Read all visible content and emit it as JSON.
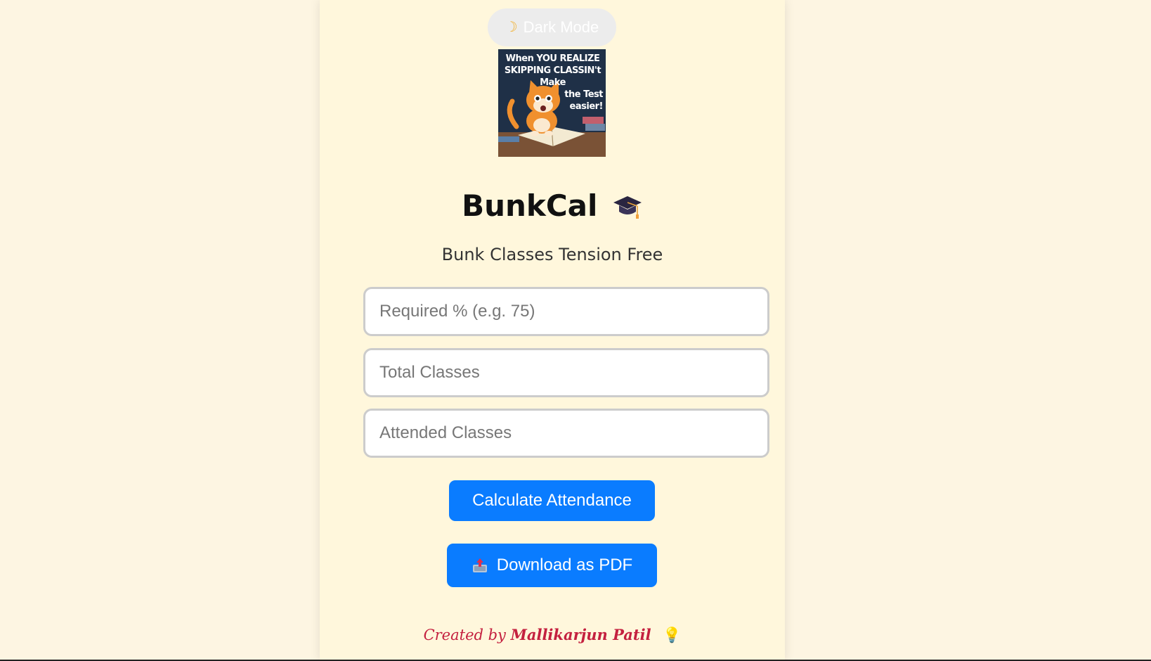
{
  "theme_toggle": {
    "icon": "moon-icon",
    "label": "Dark Mode"
  },
  "meme": {
    "caption_lines": [
      "When YOU REALIZE",
      "SKIPPING CLASSIN't Make",
      "the Test",
      "easier!"
    ]
  },
  "header": {
    "title": "BunkCal",
    "title_icon": "graduation-cap-icon",
    "subtitle": "Bunk Classes Tension Free"
  },
  "form": {
    "required_placeholder": "Required % (e.g. 75)",
    "total_placeholder": "Total Classes",
    "attended_placeholder": "Attended Classes"
  },
  "actions": {
    "calculate_label": "Calculate Attendance",
    "download_icon": "outbox-tray-icon",
    "download_label": "Download as PDF"
  },
  "footer": {
    "prefix": "Created by",
    "author": "Mallikarjun Patil",
    "icon": "light-bulb-icon"
  },
  "colors": {
    "page_bg": "#fdf5e2",
    "card_bg": "#fff7dc",
    "button": "#0a7cff",
    "credit": "#c4203f"
  }
}
